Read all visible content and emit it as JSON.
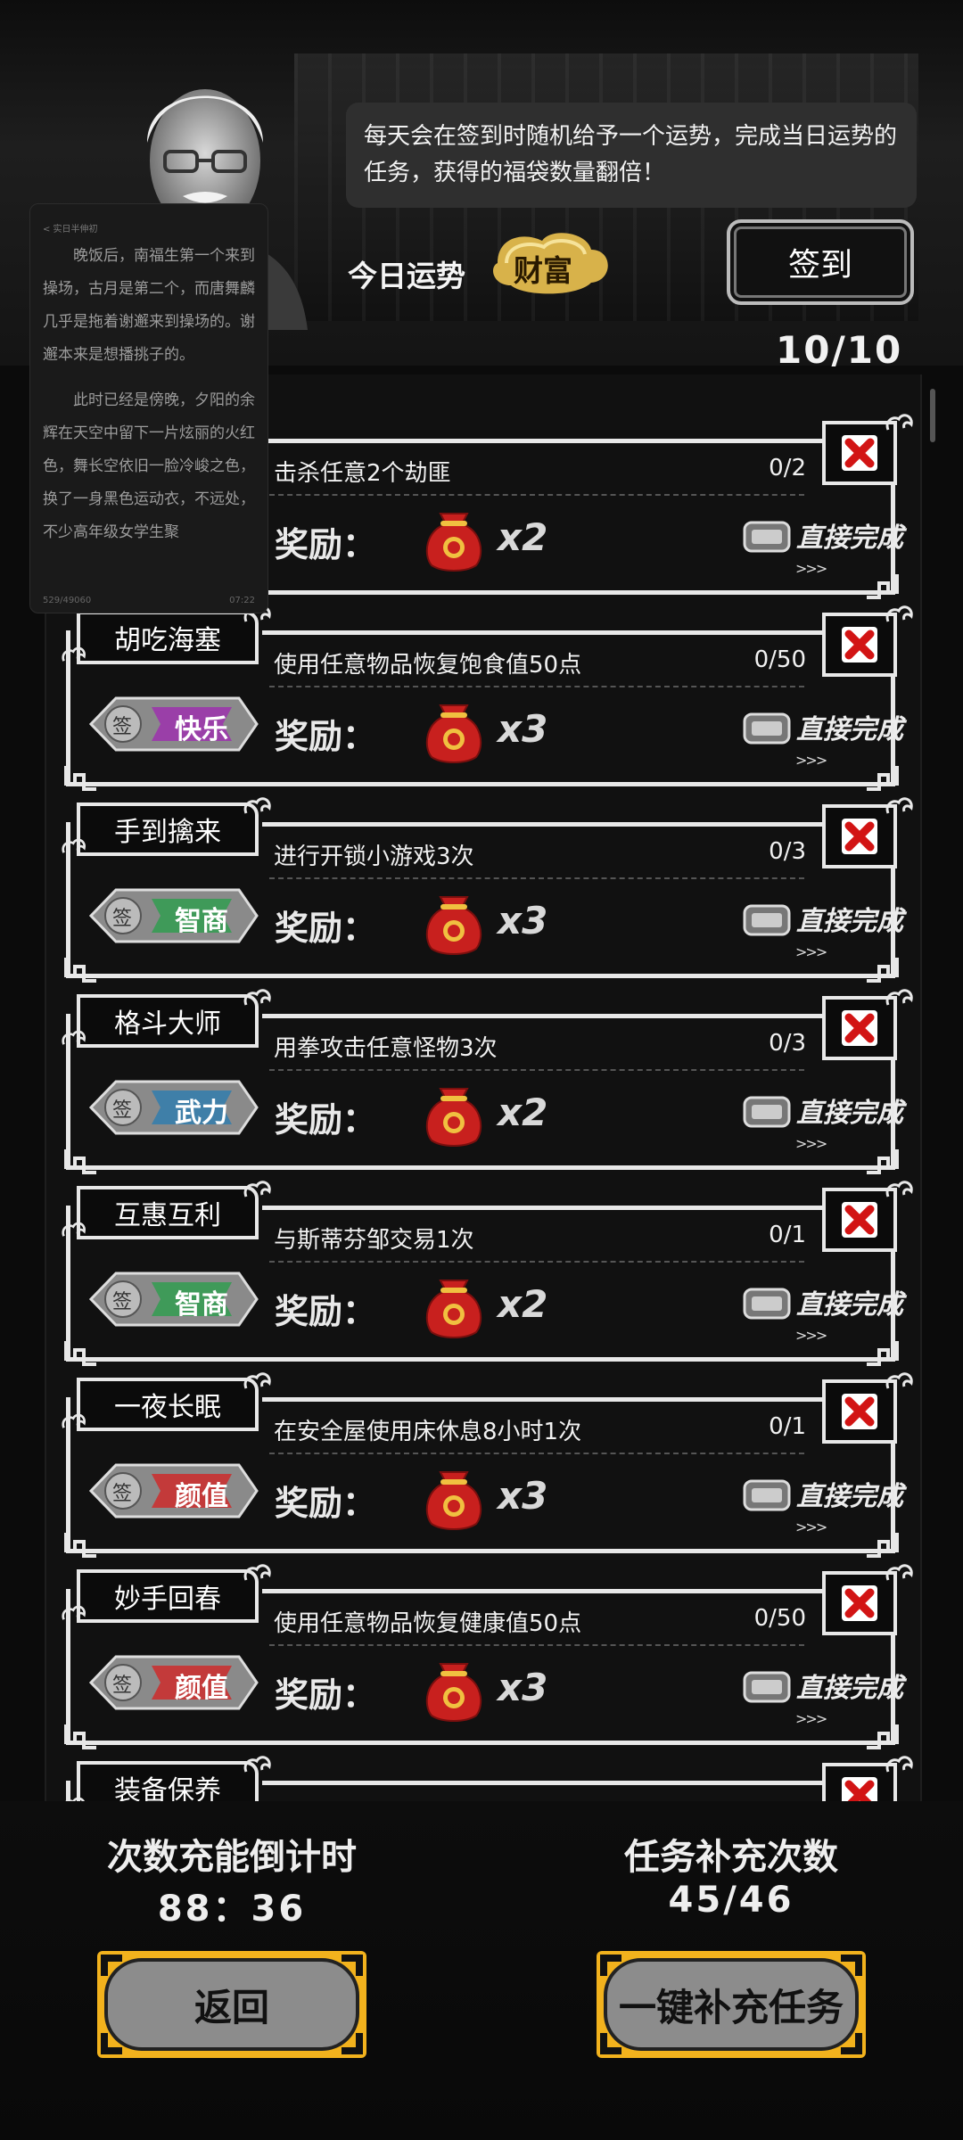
{
  "header": {
    "speech_text": "每天会在签到时随机给予一个运势，完成当日运势的任务，获得的福袋数量翻倍！",
    "fortune_label": "今日运势",
    "fortune_value": "财富",
    "signin_label": "签到",
    "task_count": "10/10"
  },
  "reader": {
    "header": "< 实日半伸初",
    "paragraphs": [
      "晚饭后，南福生第一个来到操场，古月是第二个，而唐舞麟几乎是拖着谢邂来到操场的。谢邂本来是想播挑子的。",
      "此时已经是傍晚，夕阳的余辉在天空中留下一片炫丽的火红色，舞长空依旧一脸冷峻之色，换了一身黑色运动衣，不远处，不少高年级女学生聚"
    ],
    "footer_left": "529/49060",
    "footer_right": "07:22"
  },
  "tasks": [
    {
      "name": "",
      "description": "击杀任意2个劫匪",
      "progress": "0/2",
      "tag": "",
      "tag_color": "#c33a3a",
      "reward_label": "奖励：",
      "multiplier": "x2",
      "complete_label": "直接完成"
    },
    {
      "name": "胡吃海塞",
      "description": "使用任意物品恢复饱食值50点",
      "progress": "0/50",
      "tag": "快乐",
      "tag_color": "#9a3fa8",
      "reward_label": "奖励：",
      "multiplier": "x3",
      "complete_label": "直接完成"
    },
    {
      "name": "手到擒来",
      "description": "进行开锁小游戏3次",
      "progress": "0/3",
      "tag": "智商",
      "tag_color": "#3f9a59",
      "reward_label": "奖励：",
      "multiplier": "x3",
      "complete_label": "直接完成"
    },
    {
      "name": "格斗大师",
      "description": "用拳攻击任意怪物3次",
      "progress": "0/3",
      "tag": "武力",
      "tag_color": "#3f7fa8",
      "reward_label": "奖励：",
      "multiplier": "x2",
      "complete_label": "直接完成"
    },
    {
      "name": "互惠互利",
      "description": "与斯蒂芬邹交易1次",
      "progress": "0/1",
      "tag": "智商",
      "tag_color": "#3f9a59",
      "reward_label": "奖励：",
      "multiplier": "x2",
      "complete_label": "直接完成"
    },
    {
      "name": "一夜长眠",
      "description": "在安全屋使用床休息8小时1次",
      "progress": "0/1",
      "tag": "颜值",
      "tag_color": "#c33a3a",
      "reward_label": "奖励：",
      "multiplier": "x3",
      "complete_label": "直接完成"
    },
    {
      "name": "妙手回春",
      "description": "使用任意物品恢复健康值50点",
      "progress": "0/50",
      "tag": "颜值",
      "tag_color": "#c33a3a",
      "reward_label": "奖励：",
      "multiplier": "x3",
      "complete_label": "直接完成"
    },
    {
      "name": "装备保养",
      "description": "",
      "progress": "",
      "tag": "",
      "tag_color": "#c33a3a",
      "reward_label": "",
      "multiplier": "",
      "complete_label": ""
    }
  ],
  "tag_prefix": "签",
  "footer": {
    "recharge_label": "次数充能倒计时",
    "recharge_value": "88：36",
    "refill_label": "任务补充次数",
    "refill_value": "45/46",
    "back_label": "返回",
    "refill_button_label": "一键补充任务"
  }
}
